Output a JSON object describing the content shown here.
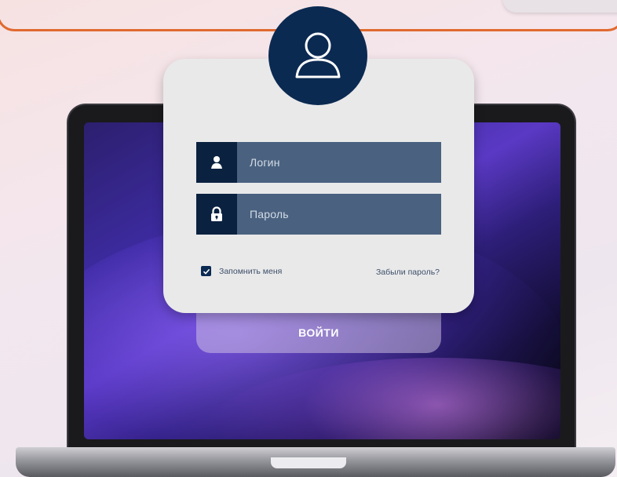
{
  "login": {
    "username_placeholder": "Логин",
    "password_placeholder": "Пароль",
    "remember_label": "Запомнить меня",
    "remember_checked": true,
    "forgot_link": "Забыли пароль?",
    "submit_label": "ВОЙТИ"
  },
  "icons": {
    "avatar": "user-avatar-icon",
    "username": "user-icon",
    "password": "lock-icon",
    "checkbox": "checkmark-icon"
  },
  "colors": {
    "accent_dark": "#0b2140",
    "field_bg": "#4a6280",
    "card_bg": "#e9e9ea",
    "frame_orange": "#e06a30"
  }
}
